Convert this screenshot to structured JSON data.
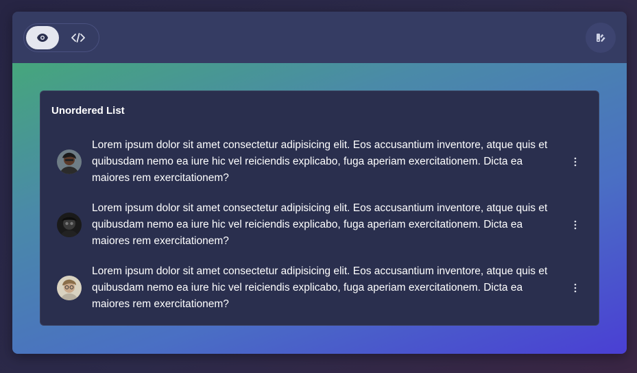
{
  "toolbar": {
    "preview_icon": "eye-icon",
    "code_icon": "code-icon",
    "theme_icon": "theme-palette-icon"
  },
  "colors": {
    "toolbar_bg": "#353c63",
    "card_bg": "#2a2f4e",
    "gradient_start": "#46a67c",
    "gradient_end": "#4a3fd4"
  },
  "card": {
    "title": "Unordered List",
    "items": [
      {
        "avatar": "avatar-person-1",
        "text": "Lorem ipsum dolor sit amet consectetur adipisicing elit. Eos accusantium inventore, atque quis et quibusdam nemo ea iure hic vel reiciendis explicabo, fuga aperiam exercitationem. Dicta ea maiores rem exercitationem?",
        "menu_icon": "more-vertical-icon"
      },
      {
        "avatar": "avatar-person-2",
        "text": "Lorem ipsum dolor sit amet consectetur adipisicing elit. Eos accusantium inventore, atque quis et quibusdam nemo ea iure hic vel reiciendis explicabo, fuga aperiam exercitationem. Dicta ea maiores rem exercitationem?",
        "menu_icon": "more-vertical-icon"
      },
      {
        "avatar": "avatar-person-3",
        "text": "Lorem ipsum dolor sit amet consectetur adipisicing elit. Eos accusantium inventore, atque quis et quibusdam nemo ea iure hic vel reiciendis explicabo, fuga aperiam exercitationem. Dicta ea maiores rem exercitationem?",
        "menu_icon": "more-vertical-icon"
      }
    ]
  }
}
